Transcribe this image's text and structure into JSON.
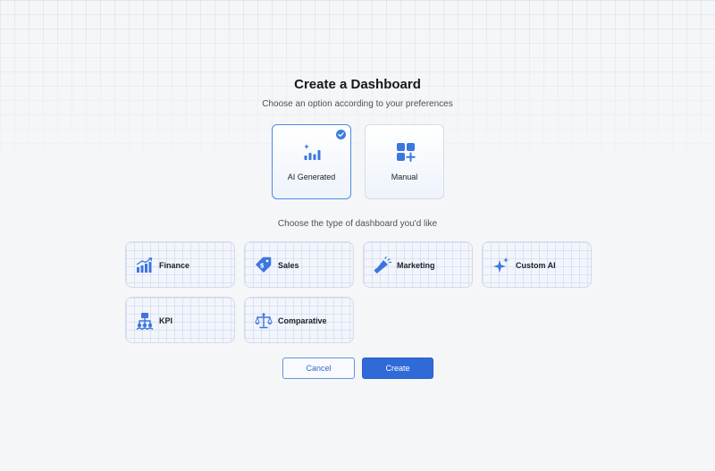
{
  "header": {
    "title": "Create a Dashboard",
    "subtitle": "Choose an option according to your preferences"
  },
  "modes": [
    {
      "label": "AI Generated",
      "icon": "ai-sparkle-chart-icon",
      "selected": true
    },
    {
      "label": "Manual",
      "icon": "grid-plus-icon",
      "selected": false
    }
  ],
  "types_section": {
    "label": "Choose the type of dashboard you'd like",
    "items": [
      {
        "label": "Finance",
        "icon": "finance-chart-icon"
      },
      {
        "label": "Sales",
        "icon": "sales-tag-icon"
      },
      {
        "label": "Marketing",
        "icon": "megaphone-icon"
      },
      {
        "label": "Custom AI",
        "icon": "sparkle-icon"
      },
      {
        "label": "KPI",
        "icon": "kpi-hierarchy-icon"
      },
      {
        "label": "Comparative",
        "icon": "balance-scale-icon"
      }
    ]
  },
  "actions": {
    "cancel_label": "Cancel",
    "create_label": "Create"
  },
  "colors": {
    "accent": "#2f6ad8",
    "icon_blue": "#3b76e1",
    "background": "#f5f6f8"
  }
}
